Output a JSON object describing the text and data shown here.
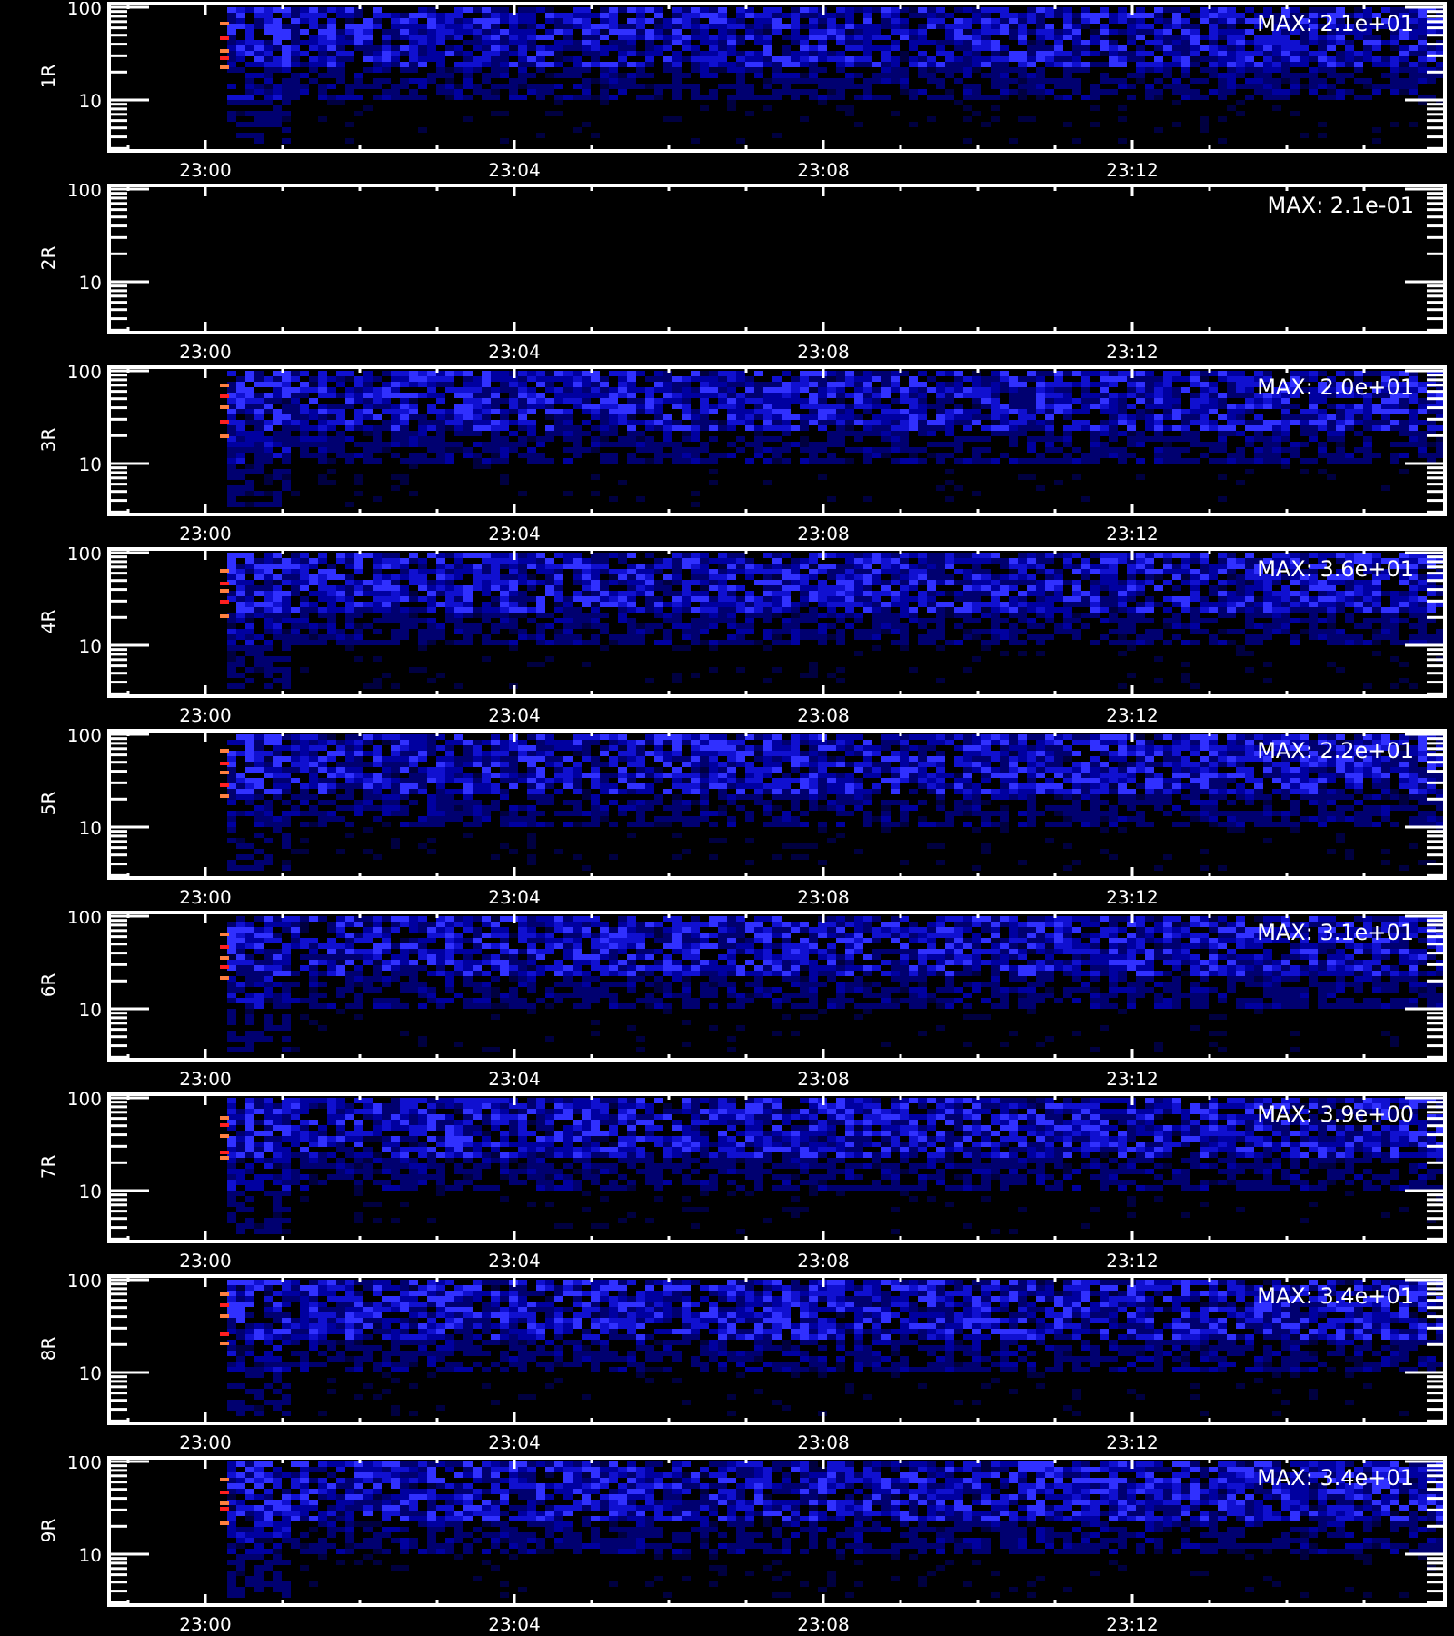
{
  "panels": [
    {
      "label": "1R",
      "kind": "spectrogram",
      "max_label": "MAX: 2.1e+01",
      "y_ticks": [
        "100",
        "10"
      ],
      "x_ticks": [
        "23:00",
        "23:04",
        "23:08",
        "23:12"
      ]
    },
    {
      "label": "2R",
      "kind": "blank",
      "max_label": "MAX: 2.1e-01",
      "y_ticks": [
        "100",
        "10"
      ],
      "x_ticks": [
        "23:00",
        "23:04",
        "23:08",
        "23:12"
      ]
    },
    {
      "label": "3R",
      "kind": "spectrogram",
      "max_label": "MAX: 2.0e+01",
      "y_ticks": [
        "100",
        "10"
      ],
      "x_ticks": [
        "23:00",
        "23:04",
        "23:08",
        "23:12"
      ]
    },
    {
      "label": "4R",
      "kind": "spectrogram",
      "max_label": "MAX: 3.6e+01",
      "y_ticks": [
        "100",
        "10"
      ],
      "x_ticks": [
        "23:00",
        "23:04",
        "23:08",
        "23:12"
      ]
    },
    {
      "label": "5R",
      "kind": "spectrogram",
      "max_label": "MAX: 2.2e+01",
      "y_ticks": [
        "100",
        "10"
      ],
      "x_ticks": [
        "23:00",
        "23:04",
        "23:08",
        "23:12"
      ]
    },
    {
      "label": "6R",
      "kind": "spectrogram",
      "max_label": "MAX: 3.1e+01",
      "y_ticks": [
        "100",
        "10"
      ],
      "x_ticks": [
        "23:00",
        "23:04",
        "23:08",
        "23:12"
      ]
    },
    {
      "label": "7R",
      "kind": "spectrogram",
      "max_label": "MAX: 3.9e+00",
      "y_ticks": [
        "100",
        "10"
      ],
      "x_ticks": [
        "23:00",
        "23:04",
        "23:08",
        "23:12"
      ]
    },
    {
      "label": "8R",
      "kind": "spectrogram",
      "max_label": "MAX: 3.4e+01",
      "y_ticks": [
        "100",
        "10"
      ],
      "x_ticks": [
        "23:00",
        "23:04",
        "23:08",
        "23:12"
      ]
    },
    {
      "label": "9R",
      "kind": "spectrogram",
      "max_label": "MAX: 3.4e+01",
      "y_ticks": [
        "100",
        "10"
      ],
      "x_ticks": [
        "23:00",
        "23:04",
        "23:08",
        "23:12"
      ]
    }
  ]
}
